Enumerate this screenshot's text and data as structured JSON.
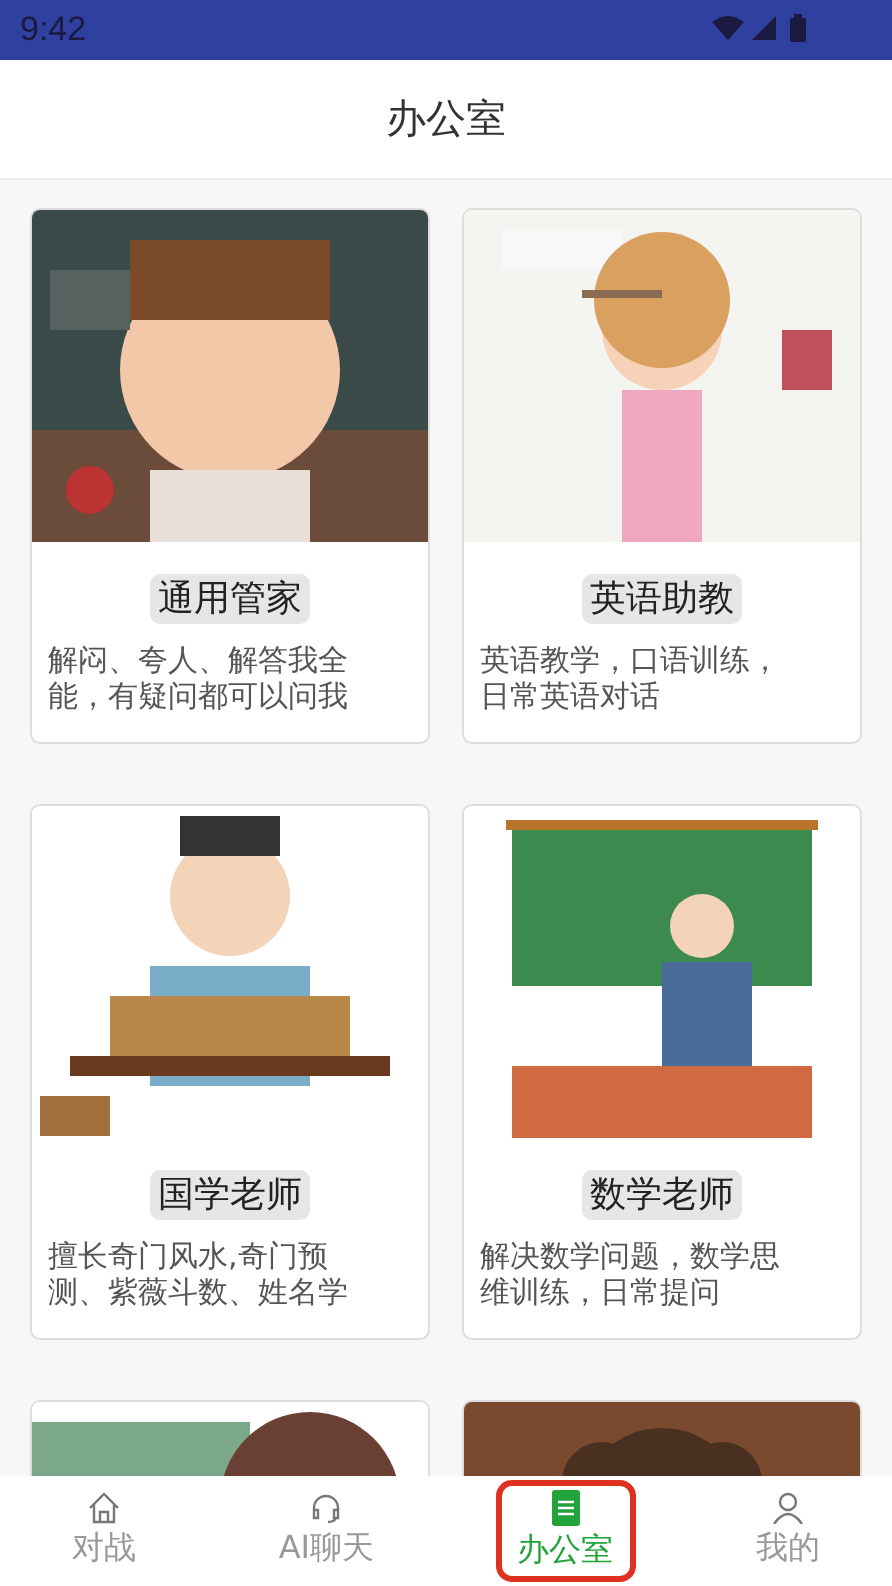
{
  "status_bar": {
    "time": "9:42"
  },
  "header": {
    "title": "办公室"
  },
  "cards": [
    {
      "picture": {
        "kind": "picture"
      },
      "name": "通用管家",
      "description": "解闷、夸人、解答我全能，有疑问都可以问我"
    },
    {
      "picture": {
        "kind": "picture"
      },
      "name": "英语助教",
      "description": "英语教学，口语训练，日常英语对话"
    },
    {
      "picture": {
        "kind": "picture"
      },
      "name": "国学老师",
      "description": "擅长奇门风水,奇门预测、紫薇斗数、姓名学"
    },
    {
      "picture": {
        "kind": "picture"
      },
      "name": "数学老师",
      "description": "解决数学问题，数学思维训练，日常提问"
    },
    {
      "picture": {
        "kind": "picture"
      }
    },
    {
      "picture": {
        "kind": "picture"
      }
    }
  ],
  "tabs": [
    {
      "label": "对战",
      "selected": false
    },
    {
      "label": "AI聊天",
      "selected": false
    },
    {
      "label": "办公室",
      "selected": true
    },
    {
      "label": "我的",
      "selected": false
    }
  ]
}
